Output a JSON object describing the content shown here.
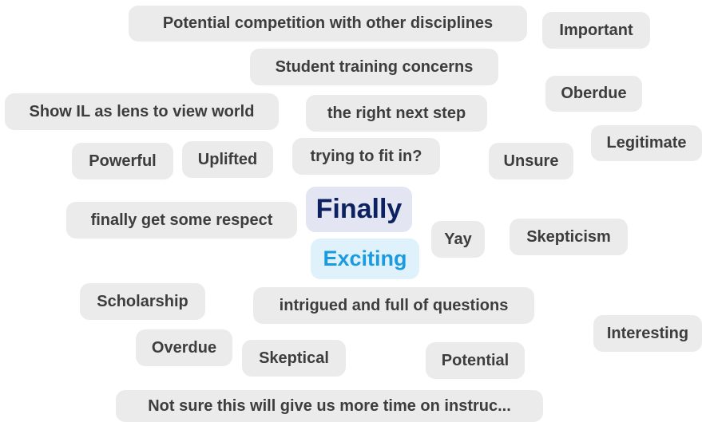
{
  "colors": {
    "pill_background": "#ebebeb",
    "pill_text": "#3d3d3d",
    "primary_background": "#e3e6f2",
    "primary_text": "#0b2161",
    "secondary_background": "#dff2fb",
    "secondary_text": "#1a9be0"
  },
  "words": [
    {
      "id": "potential-competition",
      "text": "Potential competition with other disciplines"
    },
    {
      "id": "important",
      "text": "Important"
    },
    {
      "id": "student-training-concerns",
      "text": "Student training concerns"
    },
    {
      "id": "oberdue",
      "text": "Oberdue"
    },
    {
      "id": "show-il-lens",
      "text": "Show IL as lens to view world"
    },
    {
      "id": "right-next-step",
      "text": "the right next step"
    },
    {
      "id": "legitimate",
      "text": "Legitimate"
    },
    {
      "id": "powerful",
      "text": "Powerful"
    },
    {
      "id": "uplifted",
      "text": "Uplifted"
    },
    {
      "id": "trying-to-fit-in",
      "text": "trying to fit in?"
    },
    {
      "id": "unsure",
      "text": "Unsure"
    },
    {
      "id": "finally",
      "text": "Finally"
    },
    {
      "id": "finally-get-respect",
      "text": "finally get some respect"
    },
    {
      "id": "yay",
      "text": "Yay"
    },
    {
      "id": "skepticism",
      "text": "Skepticism"
    },
    {
      "id": "exciting",
      "text": "Exciting"
    },
    {
      "id": "scholarship",
      "text": "Scholarship"
    },
    {
      "id": "intrigued",
      "text": "intrigued and full of questions"
    },
    {
      "id": "interesting",
      "text": "Interesting"
    },
    {
      "id": "overdue",
      "text": "Overdue"
    },
    {
      "id": "skeptical",
      "text": "Skeptical"
    },
    {
      "id": "potential",
      "text": "Potential"
    },
    {
      "id": "not-sure-more-time",
      "text": "Not sure this will give us more time on instruc..."
    }
  ]
}
